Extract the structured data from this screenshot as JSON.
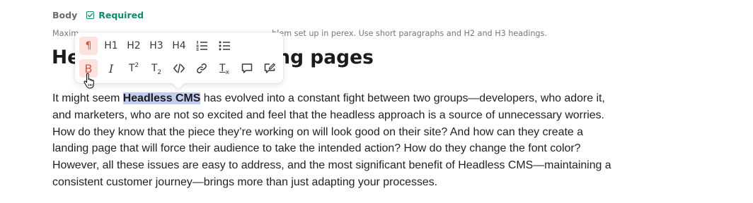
{
  "field": {
    "label": "Body",
    "required_label": "Required",
    "hint_start": "Maxim",
    "hint_end": "blem set up in perex. Use short paragraphs and H2 and H3 headings."
  },
  "heading": {
    "start": "He",
    "end": "ing pages"
  },
  "body": {
    "lines": [
      {
        "before": "It might seem ",
        "selected": "Headless CMS",
        "after": " has evolved into a constant fight between two groups—developers, who adore it,"
      },
      {
        "text": "and marketers, who are not so excited and feel that the headless approach is a source of unnecessary worries."
      },
      {
        "text": "How do they know that the piece they’re working on will look good on their site? And how can they create a"
      },
      {
        "text": "landing page that will force their audience to take the intended action? How do they change the font color?"
      },
      {
        "text": "However, all these issues are easy to address, and the most significant benefit of Headless CMS—maintaining a"
      },
      {
        "text": "consistent customer journey—brings more than just adapting your processes."
      }
    ]
  },
  "toolbar": {
    "paragraph_label": "¶",
    "h1_label": "H1",
    "h2_label": "H2",
    "h3_label": "H3",
    "h4_label": "H4",
    "bold_label": "B",
    "italic_label": "I",
    "superscript_base": "T",
    "superscript_mark": "2",
    "subscript_base": "T",
    "subscript_mark": "2",
    "clear_format_base": "T",
    "clear_format_mark": "x",
    "active_button": "bold",
    "accent_color": "#e0533f",
    "required_color": "#0f8a6b",
    "selection_color": "#c3cdef"
  }
}
